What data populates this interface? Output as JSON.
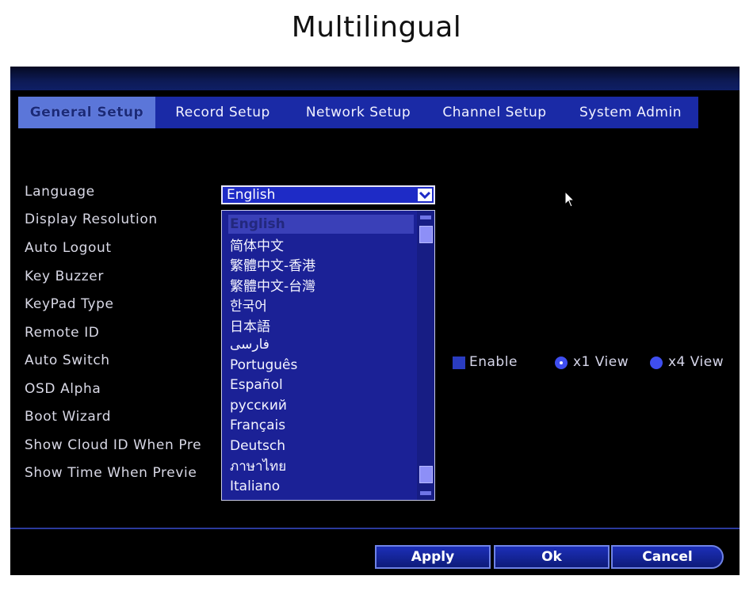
{
  "heading": "Multilingual",
  "tabs": [
    {
      "label": "General Setup"
    },
    {
      "label": "Record Setup"
    },
    {
      "label": "Network Setup"
    },
    {
      "label": "Channel Setup"
    },
    {
      "label": "System Admin"
    }
  ],
  "settings": [
    {
      "label": "Language"
    },
    {
      "label": "Display Resolution"
    },
    {
      "label": "Auto Logout"
    },
    {
      "label": "Key Buzzer"
    },
    {
      "label": "KeyPad Type"
    },
    {
      "label": "Remote ID"
    },
    {
      "label": "Auto Switch"
    },
    {
      "label": "OSD Alpha"
    },
    {
      "label": "Boot Wizard"
    },
    {
      "label": "Show Cloud ID When Pre"
    },
    {
      "label": "Show Time When Previe"
    }
  ],
  "language": {
    "selected": "English",
    "options": [
      "English",
      "简体中文",
      "繁體中文-香港",
      "繁體中文-台灣",
      "한국어",
      "日本語",
      "فارسی",
      "Português",
      "Español",
      "русский",
      "Français",
      "Deutsch",
      "ภาษาไทย",
      "Italiano"
    ]
  },
  "auto_switch": {
    "enable_label": "Enable",
    "view_x1_label": "x1 View",
    "view_x4_label": "x4 View",
    "selected_view": "x1 View"
  },
  "buttons": {
    "apply": "Apply",
    "ok": "Ok",
    "cancel": "Cancel"
  },
  "colors": {
    "tab_bar": "#1a2aa6",
    "active_tab": "#5b76d9",
    "dropdown_bg": "#1b2196",
    "button_border": "#6e82e6"
  },
  "icons": {
    "dropdown_arrow": "chevron-down-icon",
    "mouse_cursor": "mouse-pointer-icon"
  }
}
